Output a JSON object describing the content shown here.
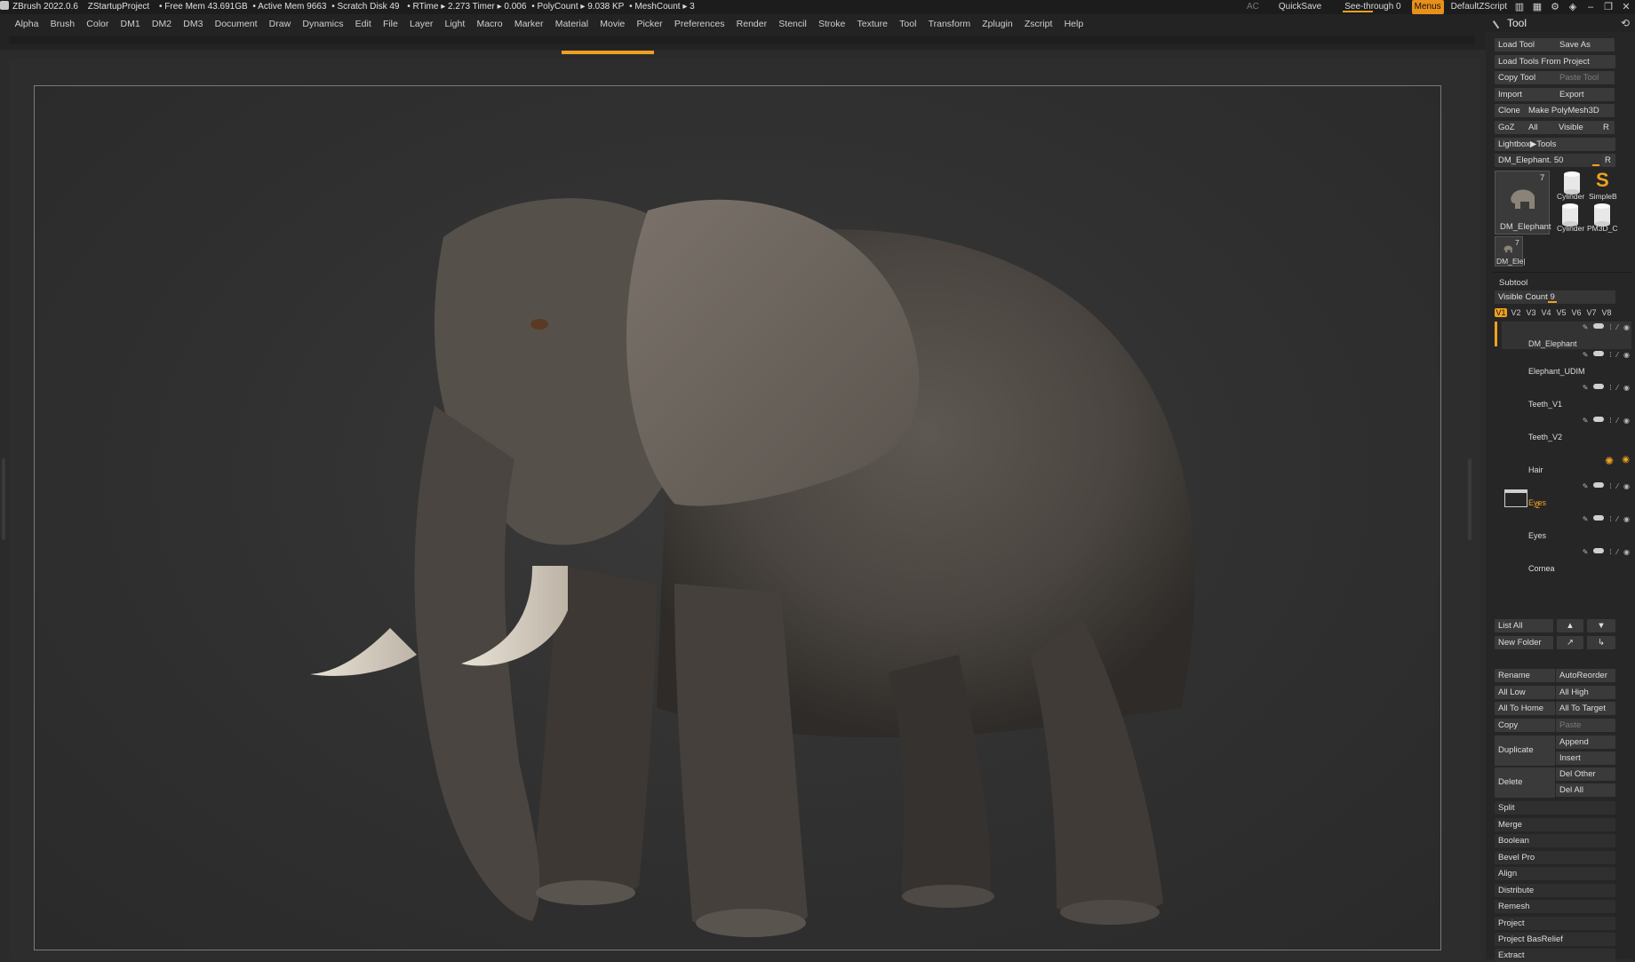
{
  "titlebar": {
    "app": "ZBrush 2022.0.6",
    "project": "ZStartupProject",
    "free_mem": "• Free Mem 43.691GB",
    "active_mem": "• Active Mem 9663",
    "scratch": "• Scratch Disk 49",
    "rtime": "• RTime ▸ 2.273 Timer ▸ 0.006",
    "polycount": "• PolyCount ▸ 9.038 KP",
    "meshcount": "• MeshCount ▸ 3",
    "ac": "AC",
    "quicksave": "QuickSave",
    "seethrough": "See-through  0",
    "menus": "Menus",
    "script": "DefaultZScript"
  },
  "menubar": {
    "items": [
      "Alpha",
      "Brush",
      "Color",
      "DM1",
      "DM2",
      "DM3",
      "Document",
      "Draw",
      "Dynamics",
      "Edit",
      "File",
      "Layer",
      "Light",
      "Macro",
      "Marker",
      "Material",
      "Movie",
      "Picker",
      "Preferences",
      "Render",
      "Stencil",
      "Stroke",
      "Texture",
      "Tool",
      "Transform",
      "Zplugin",
      "Zscript",
      "Help"
    ]
  },
  "tool": {
    "title": "Tool",
    "load_tool": "Load Tool",
    "save_as": "Save As",
    "load_from_project": "Load Tools From Project",
    "copy_tool": "Copy Tool",
    "paste_tool": "Paste Tool",
    "import": "Import",
    "export": "Export",
    "clone": "Clone",
    "make_polymesh": "Make PolyMesh3D",
    "goz": "GoZ",
    "all": "All",
    "visible": "Visible",
    "r": "R",
    "lightbox": "Lightbox▶Tools",
    "current_tool": "DM_Elephant. 50",
    "current_r": "R",
    "thumb_count": "7",
    "thumb_name": "DM_Elephant",
    "cyl1": "Cylinder",
    "simpleb": "SimpleB",
    "cyl2": "Cylinder",
    "pm3d": "PM3D_C",
    "small_count": "7",
    "small_name": "DM_Ele|"
  },
  "subtool": {
    "title": "Subtool",
    "visible_count": "Visible Count 9",
    "tabs": [
      "V1",
      "V2",
      "V3",
      "V4",
      "V5",
      "V6",
      "V7",
      "V8"
    ],
    "rows": [
      {
        "name": "DM_Elephant"
      },
      {
        "name": "Elephant_UDIM"
      },
      {
        "name": "Teeth_V1"
      },
      {
        "name": "Teeth_V2"
      },
      {
        "name": "Hair"
      },
      {
        "name": "Eyes"
      },
      {
        "name": "Eyes"
      },
      {
        "name": "Cornea"
      }
    ],
    "folder_count": "2",
    "list_all": "List All",
    "new_folder": "New Folder",
    "rename": "Rename",
    "autoreorder": "AutoReorder",
    "all_low": "All Low",
    "all_high": "All High",
    "all_to_home": "All To Home",
    "all_to_target": "All To Target",
    "copy": "Copy",
    "paste": "Paste",
    "duplicate": "Duplicate",
    "append": "Append",
    "insert": "Insert",
    "delete": "Delete",
    "del_other": "Del Other",
    "del_all": "Del All",
    "split": "Split",
    "merge": "Merge",
    "boolean": "Boolean",
    "bevel_pro": "Bevel Pro",
    "align": "Align",
    "distribute": "Distribute",
    "remesh": "Remesh",
    "project": "Project",
    "project_basrelief": "Project BasRelief",
    "extract": "Extract"
  },
  "colors": {
    "accent": "#f0a020",
    "background": "#2b2b2b",
    "panel": "#262626"
  }
}
